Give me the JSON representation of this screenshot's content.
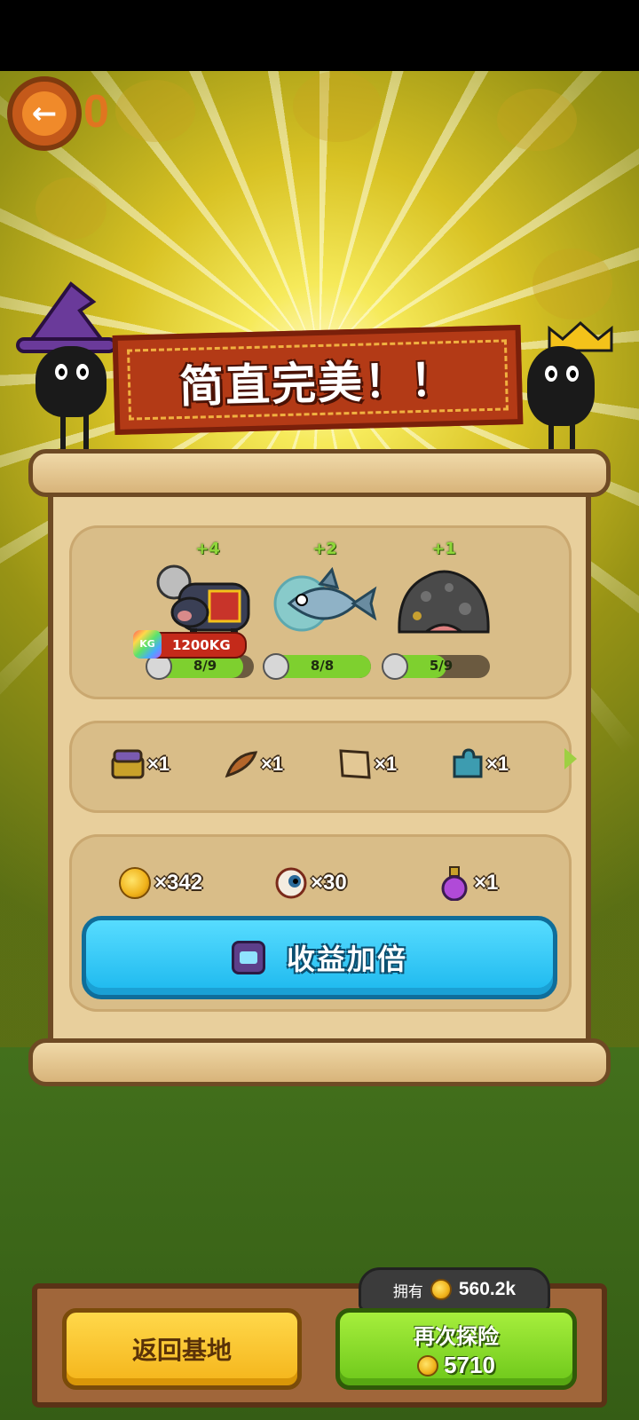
{
  "back": {
    "counter": "0"
  },
  "banner": {
    "title": "简直完美！！"
  },
  "fish": [
    {
      "plus": "+4",
      "name": "pig-chainsaw-creature",
      "progress": "8/9",
      "ratio": 0.889,
      "weight": "1200KG",
      "weight_icon": "KG"
    },
    {
      "plus": "+2",
      "name": "ghost-fish",
      "progress": "8/8",
      "ratio": 1.0
    },
    {
      "plus": "+1",
      "name": "rock-monster",
      "progress": "5/9",
      "ratio": 0.556
    }
  ],
  "items": [
    {
      "icon": "treasure-chest-icon",
      "count": "×1"
    },
    {
      "icon": "feather-icon",
      "count": "×1"
    },
    {
      "icon": "map-scroll-icon",
      "count": "×1"
    },
    {
      "icon": "puzzle-piece-icon",
      "count": "×1"
    }
  ],
  "rewards": [
    {
      "icon": "gold-coin-icon",
      "count": "×342"
    },
    {
      "icon": "eyeball-icon",
      "count": "×30"
    },
    {
      "icon": "potion-icon",
      "count": "×1"
    }
  ],
  "double_button": {
    "label": "收益加倍"
  },
  "footer": {
    "owned_label": "拥有",
    "owned_value": "560.2k",
    "return_label": "返回基地",
    "again_label": "再次探险",
    "again_cost": "5710"
  },
  "colors": {
    "accent_blue": "#1cb8ee",
    "accent_green": "#6dc71a",
    "accent_yellow": "#f4b41a",
    "banner_red": "#b33a16"
  }
}
